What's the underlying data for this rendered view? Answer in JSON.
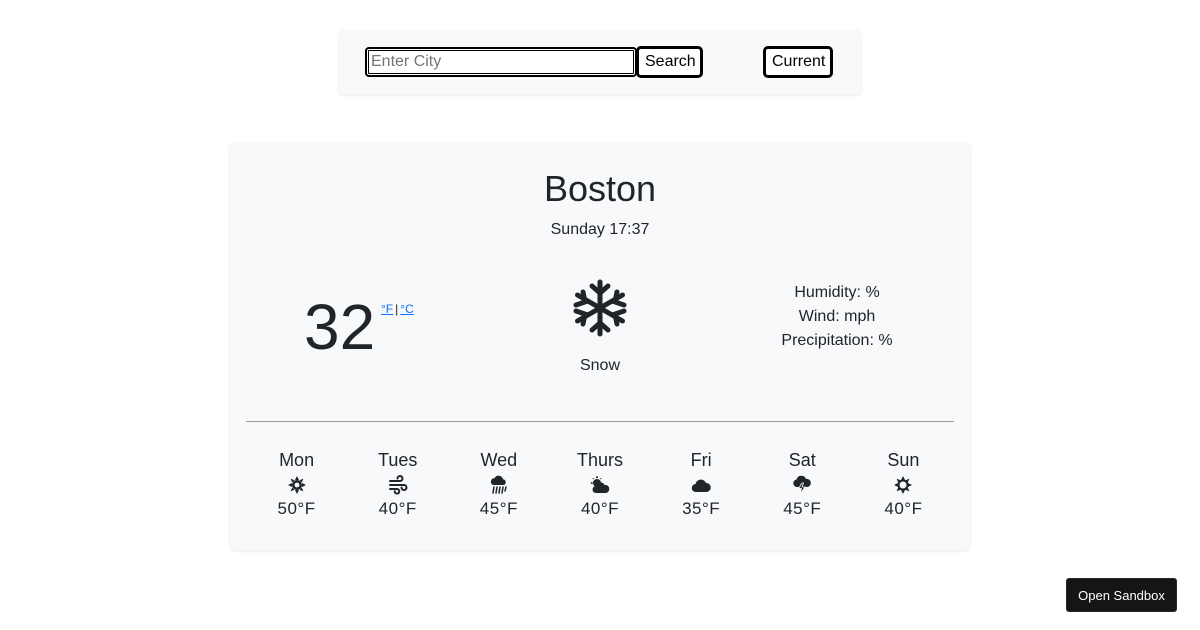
{
  "search": {
    "placeholder": "Enter City",
    "value": "",
    "search_label": "Search",
    "current_label": "Current"
  },
  "weather": {
    "city": "Boston",
    "datetime": "Sunday 17:37",
    "temperature": "32",
    "unit_f": "°F",
    "unit_separator": "|",
    "unit_c": "°C",
    "icon": "snowflake-icon",
    "condition": "Snow",
    "humidity_label": "Humidity: %",
    "wind_label": "Wind: mph",
    "precipitation_label": "Precipitation: %"
  },
  "forecast": [
    {
      "day": "Mon",
      "icon": "sun-icon",
      "temp": "50°F"
    },
    {
      "day": "Tues",
      "icon": "wind-icon",
      "temp": "40°F"
    },
    {
      "day": "Wed",
      "icon": "rain-icon",
      "temp": "45°F"
    },
    {
      "day": "Thurs",
      "icon": "partly-cloudy-icon",
      "temp": "40°F"
    },
    {
      "day": "Fri",
      "icon": "cloud-icon",
      "temp": "35°F"
    },
    {
      "day": "Sat",
      "icon": "thunderstorm-icon",
      "temp": "45°F"
    },
    {
      "day": "Sun",
      "icon": "sun-outline-icon",
      "temp": "40°F"
    }
  ],
  "sandbox": {
    "label": "Open Sandbox"
  }
}
